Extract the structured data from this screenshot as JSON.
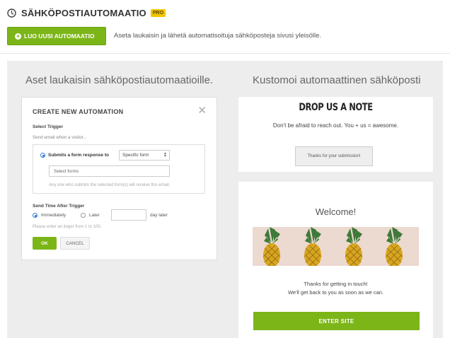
{
  "header": {
    "title": "SÄHKÖPOSTIAUTOMAATIO",
    "badge": "PRO",
    "icon": "clock-icon"
  },
  "toolbar": {
    "new_button_label": "LUO UUSI AUTOMAATIO",
    "description": "Aseta laukaisin ja lähetä automatisoituja sähköposteja sivusi yleisölle."
  },
  "columns": {
    "left_title": "Aset laukaisin sähköpostiautomaatioille.",
    "right_title": "Kustomoi automaattinen sähköposti"
  },
  "modal": {
    "title": "CREATE NEW AUTOMATION",
    "trigger_label": "Select Trigger",
    "trigger_hint": "Send email when a visitor...",
    "trigger_option": "Submits a form response to",
    "trigger_select_value": "Specific form",
    "forms_placeholder": "Select forms",
    "trigger_help": "Any one who submits the selected form(s) will receive this email.",
    "send_time_label": "Send Time After Trigger",
    "option_immediately": "Immediately",
    "option_later": "Later",
    "day_later": "day later",
    "error_text": "Please enter an iteger from 1 to 100.",
    "ok_label": "OK",
    "cancel_label": "CANCEL"
  },
  "preview1": {
    "heading": "DROP US A NOTE",
    "subtext": "Don't be afraid to reach out. You + us = awesome.",
    "button_label": "Thanks for your submission!"
  },
  "preview2": {
    "heading": "Welcome!",
    "message_line1": "Thanks for getting in touch!",
    "message_line2": "We'll get back to you as soon as we can.",
    "button_label": "ENTER SITE"
  },
  "colors": {
    "accent": "#7cb518",
    "badge": "#f2c500",
    "radio": "#2e7bd6",
    "panel_bg": "#ededed"
  }
}
